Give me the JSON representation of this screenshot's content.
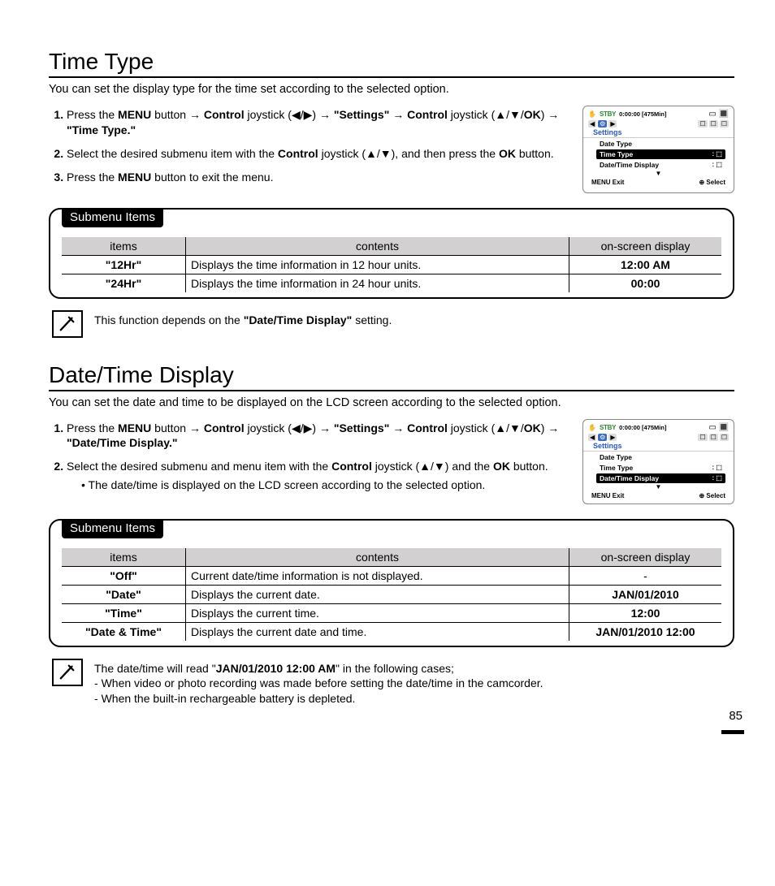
{
  "section1": {
    "title": "Time Type",
    "intro": "You can set the display type for the time set according to the selected option.",
    "steps": {
      "s1a": "Press the ",
      "s1_menu": "MENU",
      "s1b": " button → ",
      "s1_control": "Control",
      "s1c": " joystick (◀/▶) → ",
      "s1_settings": "\"Settings\"",
      "s1d": " → ",
      "s1e": " joystick (▲/▼/",
      "s1_ok": "OK",
      "s1f": ") → ",
      "s1_timetype": "\"Time Type.\"",
      "s2a": "Select the desired submenu item with the ",
      "s2b": " joystick (▲/▼), and then press the ",
      "s2c": " button.",
      "s3a": "Press the ",
      "s3b": " button to exit the menu."
    },
    "submenu_label": "Submenu Items",
    "th_items": "items",
    "th_contents": "contents",
    "th_osd": "on-screen display",
    "rows": [
      {
        "item": "\"12Hr\"",
        "content": "Displays the time information in 12 hour units.",
        "osd": "12:00 AM"
      },
      {
        "item": "\"24Hr\"",
        "content": "Displays the time information in 24 hour units.",
        "osd": "00:00"
      }
    ],
    "note_a": "This function depends on the ",
    "note_b": "\"Date/Time Display\"",
    "note_c": " setting.",
    "lcd": {
      "stby": "STBY",
      "counter": "0:00:00 [475Min]",
      "settings": "Settings",
      "items": [
        "Date Type",
        "Time Type",
        "Date/Time Display"
      ],
      "menu": "MENU",
      "exit": "Exit",
      "select": "Select"
    }
  },
  "section2": {
    "title": "Date/Time Display",
    "intro": "You can set the date and time to be displayed on the LCD screen according to the selected option.",
    "steps": {
      "s1_end": "\"Date/Time Display.\"",
      "s2a": "Select the desired submenu and menu item with the ",
      "s2b": " joystick (▲/▼) and the ",
      "s2c": " button.",
      "bullet": "The date/time is displayed on the LCD screen according to the selected option."
    },
    "rows": [
      {
        "item": "\"Off\"",
        "content": "Current date/time information is not displayed.",
        "osd": "-"
      },
      {
        "item": "\"Date\"",
        "content": "Displays the current date.",
        "osd": "JAN/01/2010"
      },
      {
        "item": "\"Time\"",
        "content": "Displays the current time.",
        "osd": "12:00"
      },
      {
        "item": "\"Date & Time\"",
        "content": "Displays the current date and time.",
        "osd": "JAN/01/2010 12:00"
      }
    ],
    "note_a": "The date/time will read \"",
    "note_b": "JAN/01/2010 12:00 AM",
    "note_c": "\" in the following cases;",
    "note_d": "When video or photo recording was made before setting the date/time in the camcorder.",
    "note_e": "When the built-in rechargeable battery is depleted."
  },
  "page": "85"
}
